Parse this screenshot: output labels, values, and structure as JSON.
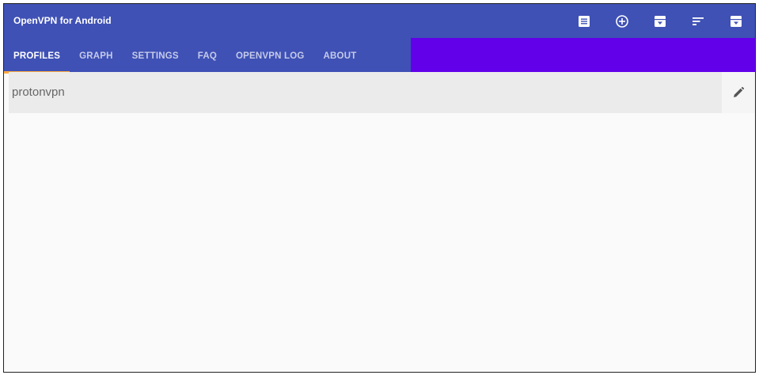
{
  "app": {
    "title": "OpenVPN for Android"
  },
  "toolbar": {
    "actions": [
      {
        "name": "view-list-icon"
      },
      {
        "name": "add-circle-icon"
      },
      {
        "name": "import-icon"
      },
      {
        "name": "sort-icon"
      },
      {
        "name": "import-icon"
      }
    ]
  },
  "tabs": [
    {
      "label": "PROFILES",
      "active": true
    },
    {
      "label": "GRAPH",
      "active": false
    },
    {
      "label": "SETTINGS",
      "active": false
    },
    {
      "label": "FAQ",
      "active": false
    },
    {
      "label": "OPENVPN LOG",
      "active": false
    },
    {
      "label": "ABOUT",
      "active": false
    }
  ],
  "profiles": [
    {
      "name": "protonvpn"
    }
  ],
  "colors": {
    "primary": "#3f51b5",
    "tab_strip_fill": "#6200ea",
    "tab_indicator": "#ffab40"
  }
}
